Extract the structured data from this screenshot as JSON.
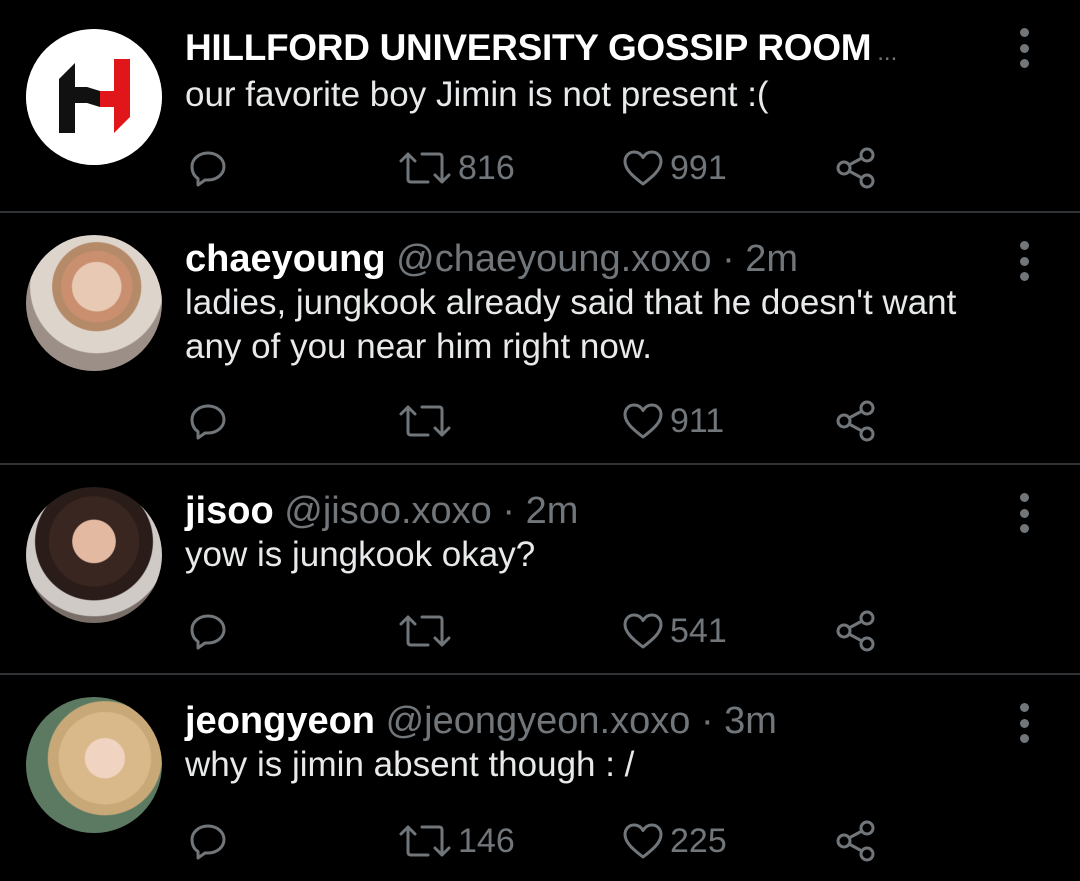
{
  "colors": {
    "background": "#000000",
    "divider": "#2f3336",
    "primary_text": "#e7e9ea",
    "secondary_text": "#71767b",
    "logo_red": "#e0161b"
  },
  "tweets": [
    {
      "name": "HILLFORD UNIVERSITY GOSSIP ROOM",
      "ellipsis": "...",
      "text": "our favorite boy Jimin is not present :(",
      "retweets": "816",
      "likes": "991",
      "avatar": "hillford-logo"
    },
    {
      "name": "chaeyoung",
      "handle": "@chaeyoung.xoxo",
      "time": "· 2m",
      "text": "ladies, jungkook already said that he doesn't want any of you near him right now.",
      "retweets": "",
      "likes": "911",
      "avatar": "photo-avatar"
    },
    {
      "name": "jisoo",
      "handle": "@jisoo.xoxo",
      "time": "· 2m",
      "text": "yow is jungkook okay?",
      "retweets": "",
      "likes": "541",
      "avatar": "photo-avatar"
    },
    {
      "name": "jeongyeon",
      "handle": "@jeongyeon.xoxo",
      "time": "· 3m",
      "text": "why is jimin absent though : /",
      "retweets": "146",
      "likes": "225",
      "avatar": "photo-avatar"
    }
  ],
  "icons": {
    "reply": "comment-icon",
    "retweet": "retweet-icon",
    "like": "heart-icon",
    "share": "share-icon",
    "more": "more-vertical-icon"
  }
}
